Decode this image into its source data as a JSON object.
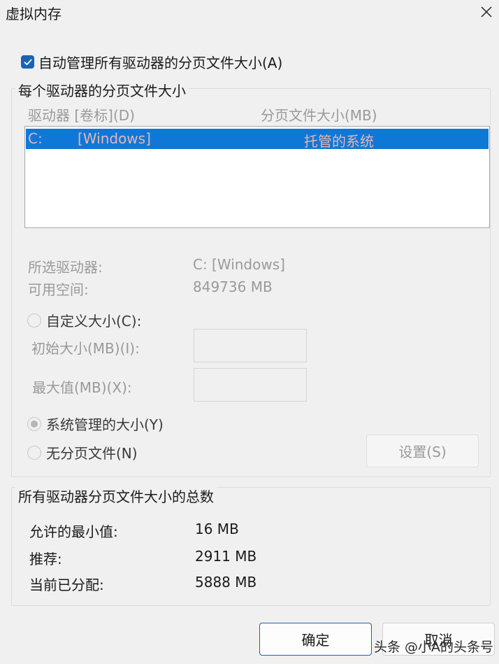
{
  "window": {
    "title": "虚拟内存",
    "close_icon": "close-icon"
  },
  "auto_manage": {
    "checked": true,
    "label": "自动管理所有驱动器的分页文件大小(A)"
  },
  "per_drive": {
    "legend": "每个驱动器的分页文件大小",
    "col_drive": "驱动器 [卷标](D)",
    "col_size": "分页文件大小(MB)",
    "drives": [
      {
        "letter": "C:",
        "label": "[Windows]",
        "size": "托管的系统",
        "selected": true
      }
    ],
    "selected_drive_label": "所选驱动器:",
    "selected_drive_value": "C:  [Windows]",
    "free_space_label": "可用空间:",
    "free_space_value": "849736 MB",
    "custom_size_label": "自定义大小(C):",
    "initial_size_label": "初始大小(MB)(I):",
    "initial_size_value": "",
    "max_size_label": "最大值(MB)(X):",
    "max_size_value": "",
    "system_managed_label": "系统管理的大小(Y)",
    "no_paging_label": "无分页文件(N)",
    "selected_option": "system_managed",
    "set_button": "设置(S)"
  },
  "totals": {
    "legend": "所有驱动器分页文件大小的总数",
    "min_label": "允许的最小值:",
    "min_value": "16 MB",
    "recommended_label": "推荐:",
    "recommended_value": "2911 MB",
    "current_label": "当前已分配:",
    "current_value": "5888 MB"
  },
  "buttons": {
    "ok": "确定",
    "cancel": "取消"
  },
  "watermark": "头条 @小A的头条号",
  "colors": {
    "accent": "#1a63b6",
    "selection": "#0f78d7",
    "disabled_text": "#9a9a9a"
  }
}
